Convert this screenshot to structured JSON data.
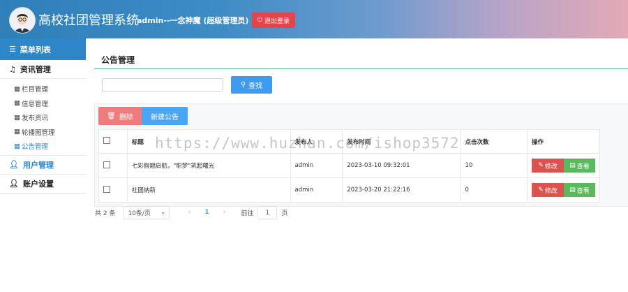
{
  "header": {
    "title": "高校社团管理系统",
    "user": "admin--一念神魔 (超级管理员)",
    "logout_label": "退出登录"
  },
  "sidebar": {
    "menu_title": "菜单列表",
    "groups": [
      {
        "label": "资讯管理",
        "items": [
          {
            "label": "栏目管理"
          },
          {
            "label": "信息管理"
          },
          {
            "label": "发布资讯"
          },
          {
            "label": "轮播图管理"
          },
          {
            "label": "公告管理"
          }
        ]
      },
      {
        "label": "用户管理"
      },
      {
        "label": "账户设置"
      }
    ]
  },
  "main": {
    "page_title": "公告管理",
    "search": {
      "value": "",
      "placeholder": ""
    },
    "search_label": "查找",
    "delete_label": "删除",
    "new_label": "新建公告",
    "table": {
      "columns": [
        "标题",
        "发布人",
        "发布时间",
        "点击次数",
        "操作"
      ],
      "rows": [
        {
          "title": "七彩假期启航，\"职梦\"筑起曙光",
          "publisher": "admin",
          "time": "2023-03-10 09:32:01",
          "clicks": "10"
        },
        {
          "title": "社团纳新",
          "publisher": "admin",
          "time": "2023-03-20 21:22:16",
          "clicks": "0"
        }
      ],
      "edit_label": "修改",
      "view_label": "查看"
    },
    "pagination": {
      "total": "共 2 条",
      "page_size": "10条/页",
      "current_page": "1",
      "goto_prefix": "前往",
      "goto_value": "1",
      "goto_suffix": "页"
    }
  },
  "watermark": "https://www.huzhan.com/ishop3572",
  "colors": {
    "header_blue": "#2f7fb8",
    "menu_blue": "#2c86c7",
    "danger": "#d9534f",
    "success": "#5cb85c",
    "primary": "#3f9bf0"
  }
}
